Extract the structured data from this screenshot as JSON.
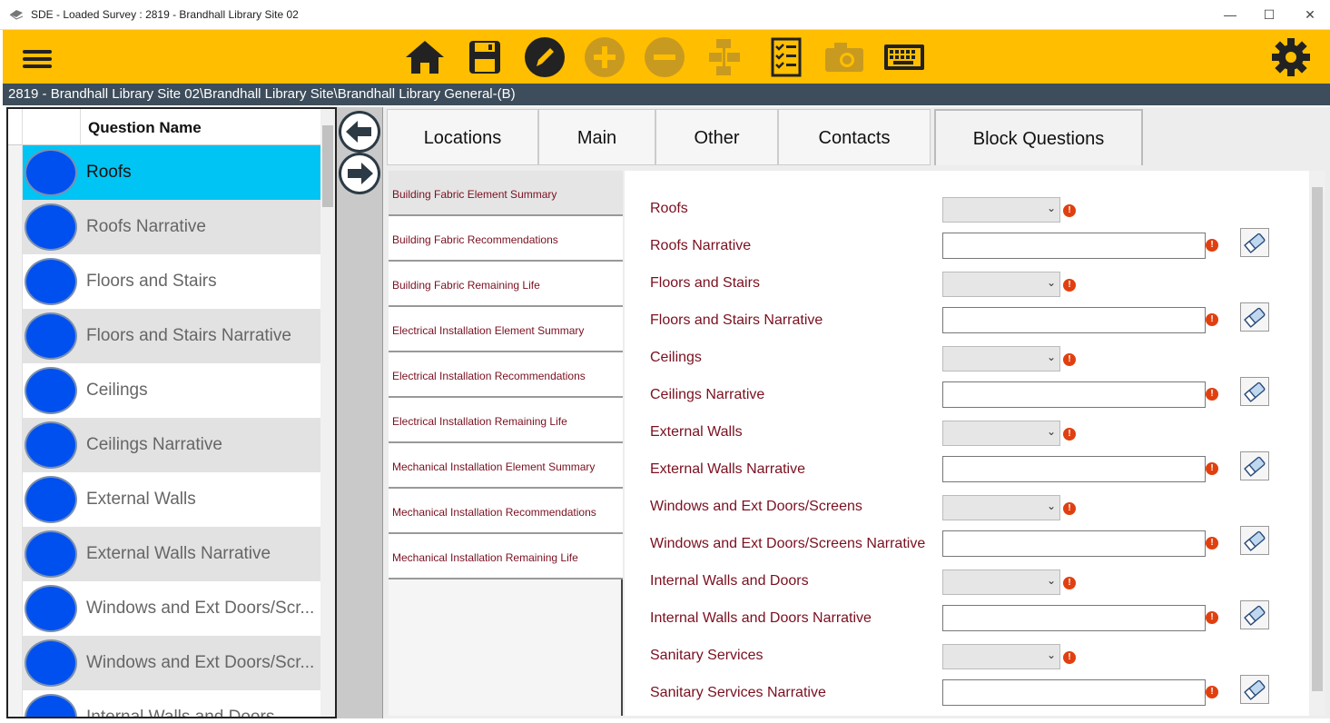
{
  "window": {
    "title": "SDE - Loaded Survey : 2819 - Brandhall Library Site 02",
    "minimize": "—",
    "maximize": "☐",
    "close": "✕"
  },
  "toolbar": {
    "accent": "#FFBE00",
    "icons": [
      "menu-icon",
      "home-icon",
      "save-icon",
      "edit-icon",
      "add-icon",
      "remove-icon",
      "hierarchy-icon",
      "checklist-icon",
      "camera-icon",
      "keyboard-icon",
      "gear-icon"
    ]
  },
  "path": "2819 - Brandhall Library Site 02\\Brandhall Library Site\\Brandhall Library General-(B)",
  "question_list": {
    "header": "Question Name",
    "items": [
      "Roofs",
      "Roofs Narrative",
      "Floors and Stairs",
      "Floors and Stairs Narrative",
      "Ceilings",
      "Ceilings Narrative",
      "External Walls",
      "External Walls Narrative",
      "Windows and Ext Doors/Scr...",
      "Windows and Ext Doors/Scr...",
      "Internal Walls and Doors"
    ]
  },
  "tabs": [
    "Locations",
    "Main",
    "Other",
    "Contacts",
    "Block Questions"
  ],
  "subnav": [
    "Building Fabric Element Summary",
    "Building Fabric Recommendations",
    "Building Fabric Remaining Life",
    "Electrical Installation Element Summary",
    "Electrical Installation Recommendations",
    "Electrical Installation Remaining Life",
    "Mechanical Installation Element Summary",
    "Mechanical Installation Recommendations",
    "Mechanical Installation Remaining Life"
  ],
  "form": {
    "fields": [
      {
        "label": "Roofs",
        "type": "dropdown"
      },
      {
        "label": "Roofs Narrative",
        "type": "text"
      },
      {
        "label": "Floors and Stairs",
        "type": "dropdown"
      },
      {
        "label": "Floors and Stairs Narrative",
        "type": "text"
      },
      {
        "label": "Ceilings",
        "type": "dropdown"
      },
      {
        "label": "Ceilings Narrative",
        "type": "text"
      },
      {
        "label": "External Walls",
        "type": "dropdown"
      },
      {
        "label": "External Walls Narrative",
        "type": "text"
      },
      {
        "label": "Windows and Ext Doors/Screens",
        "type": "dropdown"
      },
      {
        "label": "Windows and Ext Doors/Screens Narrative",
        "type": "text"
      },
      {
        "label": "Internal Walls and Doors",
        "type": "dropdown"
      },
      {
        "label": "Internal Walls and Doors Narrative",
        "type": "text"
      },
      {
        "label": "Sanitary Services",
        "type": "dropdown"
      },
      {
        "label": "Sanitary Services Narrative",
        "type": "text"
      }
    ],
    "warning_glyph": "!",
    "dropdown_chevron": "⌄"
  }
}
